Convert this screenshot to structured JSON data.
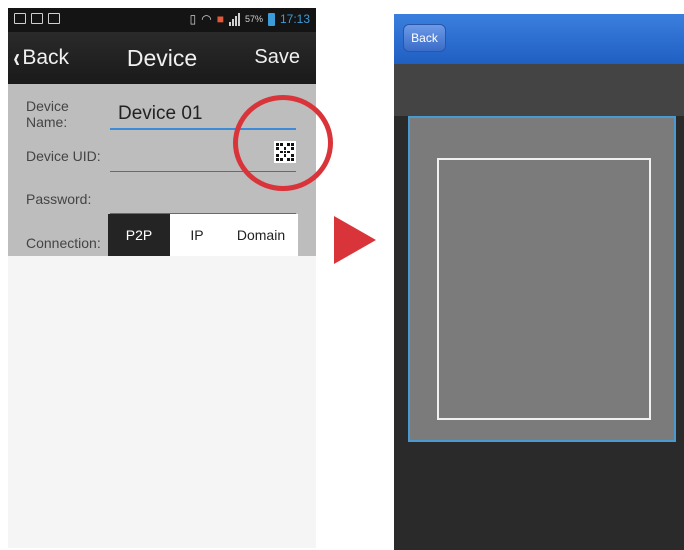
{
  "left_screen": {
    "status_bar": {
      "battery_percent": "57%",
      "time": "17:13"
    },
    "nav": {
      "back_label": "Back",
      "title": "Device",
      "save_label": "Save"
    },
    "form": {
      "device_name_label": "Device Name:",
      "device_name_value": "Device 01",
      "device_uid_label": "Device UID:",
      "device_uid_value": "",
      "password_label": "Password:",
      "password_value": "",
      "connection_label": "Connection:",
      "connection_options": [
        "P2P",
        "IP",
        "Domain"
      ],
      "connection_selected": "P2P"
    }
  },
  "right_screen": {
    "back_label": "Back"
  },
  "colors": {
    "highlight_red": "#d9343a",
    "header_blue": "#1f5fc2",
    "accent_blue": "#3d9bd8"
  }
}
